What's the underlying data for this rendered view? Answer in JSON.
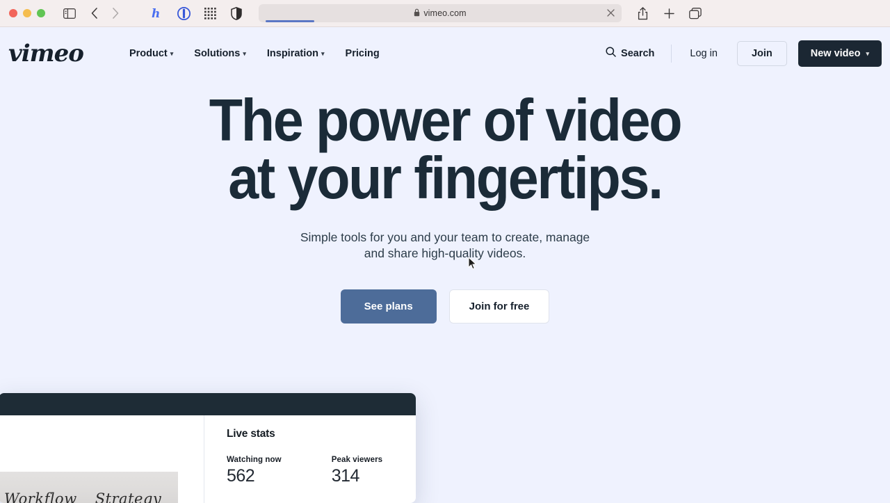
{
  "browser": {
    "traffic_lights": [
      "close",
      "minimize",
      "maximize"
    ],
    "sidebar_toggle_name": "sidebar-toggle",
    "back_label": "Back",
    "forward_label": "Forward",
    "extensions": [
      "honey-icon",
      "onepassword-icon",
      "apps-grid-icon",
      "privacy-shield-icon"
    ],
    "url": "vimeo.com",
    "lock_icon": "lock-icon",
    "stop_icon": "close-icon",
    "share_icon": "share-icon",
    "new_tab_icon": "plus-icon",
    "tabs_overview_icon": "tabs-overview-icon",
    "loading": true
  },
  "nav": {
    "logo": "vimeo",
    "links": [
      {
        "label": "Product",
        "has_caret": true
      },
      {
        "label": "Solutions",
        "has_caret": true
      },
      {
        "label": "Inspiration",
        "has_caret": true
      },
      {
        "label": "Pricing",
        "has_caret": false
      }
    ],
    "search_label": "Search",
    "login_label": "Log in",
    "join_label": "Join",
    "new_video_label": "New video",
    "new_video_bg": "#1b2733"
  },
  "hero": {
    "title_line1": "The power of video",
    "title_line2": "at your fingertips.",
    "subtitle_line1": "Simple tools for you and your team to create, manage",
    "subtitle_line2": "and share high-quality videos.",
    "primary_cta": "See plans",
    "secondary_cta": "Join for free",
    "primary_cta_color": "#4d6c99",
    "background_color": "#eff2fe",
    "title_color": "#1b2b38"
  },
  "app_card": {
    "titlebar_color": "#1e2c36",
    "whiteboard_text_1": "Workflow",
    "whiteboard_text_2": "Strategy",
    "live_stats": {
      "title": "Live stats",
      "metrics": [
        {
          "label": "Watching now",
          "value": "562"
        },
        {
          "label": "Peak viewers",
          "value": "314"
        }
      ]
    }
  }
}
